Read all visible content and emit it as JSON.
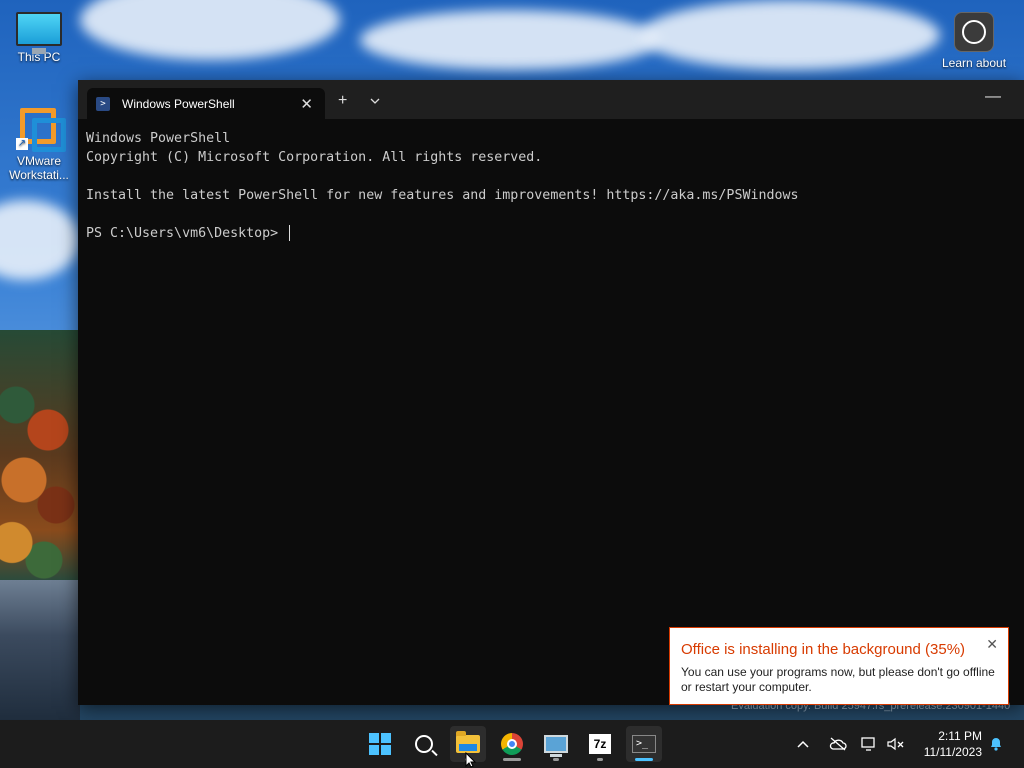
{
  "desktop": {
    "icons": [
      {
        "label": "This PC"
      },
      {
        "label": "VMware Workstati..."
      },
      {
        "label": "Learn about"
      }
    ]
  },
  "terminal": {
    "tab_title": "Windows PowerShell",
    "tab_close": "✕",
    "new_tab": "+",
    "dropdown": "⌄",
    "minimize": "—",
    "lines": [
      "Windows PowerShell",
      "Copyright (C) Microsoft Corporation. All rights reserved.",
      "",
      "Install the latest PowerShell for new features and improvements! https://aka.ms/PSWindows",
      "",
      "PS C:\\Users\\vm6\\Desktop> "
    ]
  },
  "watermark": "Evaluation copy. Build 25947.rs_prerelease.230901-1440",
  "toast": {
    "title": "Office is installing in the background (35%)",
    "progress_percent": 35,
    "body": "You can use your programs now, but please don't go offline or restart your computer.",
    "close": "✕",
    "accent_color": "#d83b01"
  },
  "taskbar": {
    "items": [
      {
        "name": "start",
        "icon": "windows-logo-icon"
      },
      {
        "name": "search",
        "icon": "search-icon"
      },
      {
        "name": "file-explorer",
        "icon": "folder-icon"
      },
      {
        "name": "chrome",
        "icon": "chrome-icon"
      },
      {
        "name": "remote-desktop",
        "icon": "remote-desktop-icon"
      },
      {
        "name": "7-zip",
        "icon": "7zip-icon",
        "glyph": "7z"
      },
      {
        "name": "terminal",
        "icon": "terminal-icon",
        "glyph": ">_"
      }
    ],
    "tray": {
      "chevron": "⌃",
      "time": "2:11 PM",
      "date": "11/11/2023"
    },
    "accent_color": "#4cc2ff"
  }
}
